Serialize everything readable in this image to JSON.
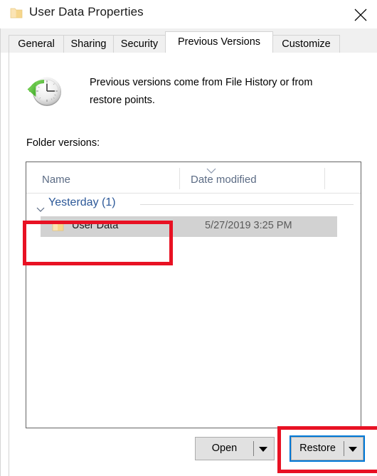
{
  "window": {
    "title": "User Data Properties",
    "title_icon": "folder-icon",
    "close_icon": "close-icon"
  },
  "tabs": [
    {
      "label": "General",
      "active": false
    },
    {
      "label": "Sharing",
      "active": false
    },
    {
      "label": "Security",
      "active": false
    },
    {
      "label": "Previous Versions",
      "active": true
    },
    {
      "label": "Customize",
      "active": false
    }
  ],
  "content": {
    "icon": "clock-restore-icon",
    "description": "Previous versions come from File History or from restore points.",
    "list_label": "Folder versions:"
  },
  "list": {
    "columns": [
      {
        "key": "name",
        "label": "Name"
      },
      {
        "key": "date",
        "label": "Date modified"
      }
    ],
    "sort_icon": "chevron-down-icon",
    "groups": [
      {
        "label": "Yesterday (1)",
        "expand_icon": "chevron-down-icon",
        "rows": [
          {
            "icon": "folder-icon",
            "name": "User Data",
            "date": "5/27/2019 3:25 PM",
            "selected": true
          }
        ]
      }
    ]
  },
  "buttons": {
    "open": {
      "label": "Open",
      "dropdown_icon": "caret-down-icon"
    },
    "restore": {
      "label": "Restore",
      "dropdown_icon": "caret-down-icon",
      "focused": true
    }
  },
  "colors": {
    "accent": "#0078d7",
    "annotation": "#e81123",
    "group_header_text": "#2c5898",
    "column_header_text": "#5b6b84",
    "selection": "#d2d2d2"
  }
}
